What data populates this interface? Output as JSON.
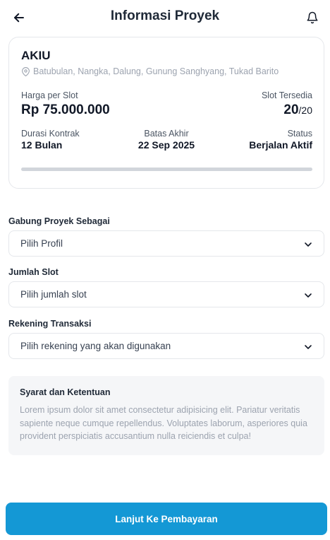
{
  "header": {
    "title": "Informasi Proyek",
    "back_icon": "arrow-left-icon",
    "notification_icon": "bell-icon"
  },
  "project": {
    "name": "AKIU",
    "location": "Batubulan, Nangka, Dalung, Gunung Sanghyang, Tukad Barito",
    "price_label": "Harga per Slot",
    "price_value": "Rp 75.000.000",
    "slot_label": "Slot Tersedia",
    "slot_available": "20",
    "slot_total": "/20",
    "duration_label": "Durasi Kontrak",
    "duration_value": "12 Bulan",
    "deadline_label": "Batas Akhir",
    "deadline_value": "22 Sep 2025",
    "status_label": "Status",
    "status_value": "Berjalan Aktif",
    "progress_fraction": 1.0
  },
  "form": {
    "profile": {
      "label": "Gabung Proyek Sebagai",
      "value": "Pilih Profil"
    },
    "slots": {
      "label": "Jumlah Slot",
      "value": "Pilih jumlah slot"
    },
    "account": {
      "label": "Rekening Transaksi",
      "value": "Pilih rekening yang akan digunakan"
    }
  },
  "terms": {
    "title": "Syarat dan Ketentuan",
    "body": "Lorem ipsum dolor sit amet consectetur adipisicing elit. Pariatur veritatis sapiente neque cumque repellendus. Voluptates laborum, asperiores quia provident perspiciatis accusantium nulla reiciendis et culpa!"
  },
  "cta": {
    "label": "Lanjut Ke Pembayaran"
  },
  "colors": {
    "primary": "#1498d5",
    "text": "#1f2937",
    "muted": "#9ca3af",
    "card_border": "#e5e7eb",
    "terms_bg": "#f5f6f8"
  }
}
